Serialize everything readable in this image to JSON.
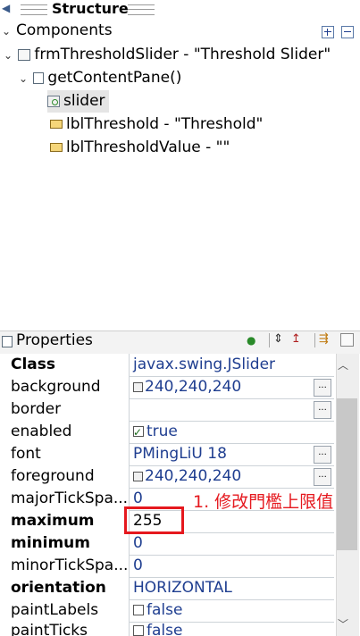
{
  "structure": {
    "title": "Structure"
  },
  "components": {
    "label": "Components"
  },
  "tree": {
    "frame": "frmThresholdSlider - \"Threshold Slider\"",
    "content_pane": "getContentPane()",
    "slider": "slider",
    "lbl_threshold": "lblThreshold - \"Threshold\"",
    "lbl_threshold_value": "lblThresholdValue - \"\""
  },
  "properties": {
    "title": "Properties",
    "rows": [
      {
        "name": "Class",
        "value": "javax.swing.JSlider"
      },
      {
        "name": "background",
        "value": "240,240,240"
      },
      {
        "name": "border",
        "value": ""
      },
      {
        "name": "enabled",
        "value": "true"
      },
      {
        "name": "font",
        "value": "PMingLiU 18"
      },
      {
        "name": "foreground",
        "value": "240,240,240"
      },
      {
        "name": "majorTickSpa...",
        "value": "0"
      },
      {
        "name": "maximum",
        "value": "255"
      },
      {
        "name": "minimum",
        "value": "0"
      },
      {
        "name": "minorTickSpa...",
        "value": "0"
      },
      {
        "name": "orientation",
        "value": "HORIZONTAL"
      },
      {
        "name": "paintLabels",
        "value": "false"
      },
      {
        "name": "paintTicks",
        "value": "false"
      }
    ],
    "ellipsis": "..."
  },
  "annotation": {
    "text": "1. 修改門檻上限值"
  },
  "colors": {
    "accent_red": "#e5181e",
    "value_blue": "#1f3e90"
  }
}
